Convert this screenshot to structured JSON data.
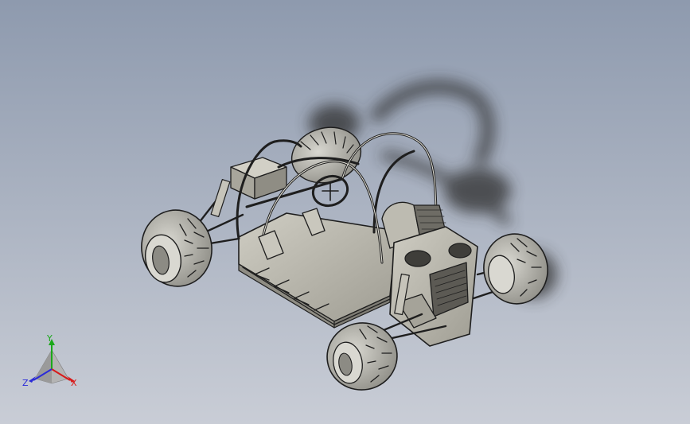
{
  "triad": {
    "x_label": "X",
    "y_label": "Y",
    "z_label": "Z"
  },
  "colors": {
    "background_top": "#8e9aae",
    "background_bottom": "#c9cdd6",
    "model_body": "#b9b7ac",
    "model_edge": "#1e1e1e",
    "tire": "#9d9c95",
    "shadow": "#3a3a3a",
    "axis_x": "#d81a1a",
    "axis_y": "#1aa81a",
    "axis_z": "#2a2ad8"
  },
  "icons": {
    "model": "dune-buggy-icon",
    "triad": "axis-triad-icon"
  }
}
